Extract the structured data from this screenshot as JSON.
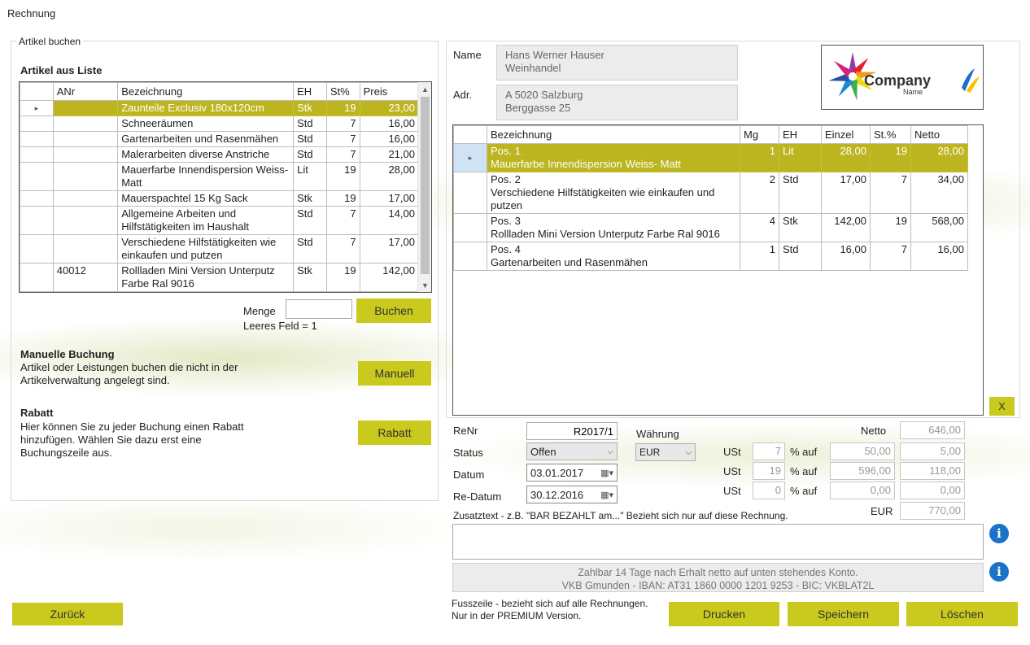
{
  "window": {
    "title": "Rechnung"
  },
  "left_panel": {
    "group_label": "Artikel buchen",
    "list_heading": "Artikel aus Liste",
    "columns": [
      "ANr",
      "Bezeichnung",
      "EH",
      "St%",
      "Preis"
    ],
    "rows": [
      {
        "anr": "",
        "bez": "Zaunteile Exclusiv 180x120cm",
        "eh": "Stk",
        "st": "19",
        "preis": "23,00",
        "selected": true
      },
      {
        "anr": "",
        "bez": "Schneeräumen",
        "eh": "Std",
        "st": "7",
        "preis": "16,00"
      },
      {
        "anr": "",
        "bez": "Gartenarbeiten und Rasenmähen",
        "eh": "Std",
        "st": "7",
        "preis": "16,00"
      },
      {
        "anr": "",
        "bez": "Malerarbeiten diverse Anstriche",
        "eh": "Std",
        "st": "7",
        "preis": "21,00"
      },
      {
        "anr": "",
        "bez": "Mauerfarbe Innendispersion Weiss- Matt",
        "eh": "Lit",
        "st": "19",
        "preis": "28,00"
      },
      {
        "anr": "",
        "bez": "Mauerspachtel 15 Kg Sack",
        "eh": "Stk",
        "st": "19",
        "preis": "17,00"
      },
      {
        "anr": "",
        "bez": "Allgemeine Arbeiten und Hilfstätigkeiten im Haushalt",
        "eh": "Std",
        "st": "7",
        "preis": "14,00"
      },
      {
        "anr": "",
        "bez": "Verschiedene Hilfstätigkeiten wie einkaufen und putzen",
        "eh": "Std",
        "st": "7",
        "preis": "17,00"
      },
      {
        "anr": "40012",
        "bez": "Rollladen Mini Version Unterputz Farbe Ral 9016",
        "eh": "Stk",
        "st": "19",
        "preis": "142,00"
      }
    ],
    "menge_label": "Menge",
    "menge_value": "",
    "menge_hint": "Leeres Feld = 1",
    "buchen_label": "Buchen",
    "manuelle_heading": "Manuelle Buchung",
    "manuelle_text": "Artikel oder Leistungen buchen die nicht in der Artikelverwaltung angelegt sind.",
    "manuell_label": "Manuell",
    "rabatt_heading": "Rabatt",
    "rabatt_text": "Hier können Sie zu jeder Buchung einen Rabatt hinzufügen. Wählen Sie dazu erst eine Buchungszeile aus.",
    "rabatt_label": "Rabatt"
  },
  "customer": {
    "name_label": "Name",
    "name_line1": "Hans Werner Hauser",
    "name_line2": "Weinhandel",
    "adr_label": "Adr.",
    "adr_line1": "A 5020 Salzburg",
    "adr_line2": "Berggasse 25",
    "logo_text": "Company",
    "logo_subtext": "Name"
  },
  "invoice_grid": {
    "columns": [
      "Bezeichnung",
      "Mg",
      "EH",
      "Einzel",
      "St.%",
      "Netto"
    ],
    "rows": [
      {
        "pos": "Pos. 1",
        "desc": "Mauerfarbe Innendispersion Weiss- Matt",
        "mg": "1",
        "eh": "Lit",
        "einzel": "28,00",
        "st": "19",
        "netto": "28,00",
        "selected": true
      },
      {
        "pos": "Pos. 2",
        "desc": "Verschiedene Hilfstätigkeiten wie einkaufen und putzen",
        "mg": "2",
        "eh": "Std",
        "einzel": "17,00",
        "st": "7",
        "netto": "34,00"
      },
      {
        "pos": "Pos. 3",
        "desc": "Rollladen Mini Version Unterputz Farbe Ral 9016",
        "mg": "4",
        "eh": "Stk",
        "einzel": "142,00",
        "st": "19",
        "netto": "568,00"
      },
      {
        "pos": "Pos. 4",
        "desc": "Gartenarbeiten und Rasenmähen",
        "mg": "1",
        "eh": "Std",
        "einzel": "16,00",
        "st": "7",
        "netto": "16,00"
      }
    ],
    "delete_label": "X"
  },
  "meta": {
    "renr_label": "ReNr",
    "renr_value": "R2017/1",
    "status_label": "Status",
    "status_value": "Offen",
    "datum_label": "Datum",
    "datum_value": "03.01.2017",
    "redatum_label": "Re-Datum",
    "redatum_value": "30.12.2016",
    "waehrung_label": "Währung",
    "waehrung_value": "EUR"
  },
  "totals": {
    "netto_label": "Netto",
    "netto_value": "646,00",
    "ust_label": "USt",
    "auf_label": "% auf",
    "ust_rows": [
      {
        "rate": "7",
        "base": "50,00",
        "amount": "5,00"
      },
      {
        "rate": "19",
        "base": "596,00",
        "amount": "118,00"
      },
      {
        "rate": "0",
        "base": "0,00",
        "amount": "0,00"
      }
    ],
    "eur_label": "EUR",
    "eur_value": "770,00"
  },
  "zusatz": {
    "label": "Zusatztext - z.B.  \"BAR BEZAHLT am...\" Bezieht sich nur auf diese Rechnung.",
    "value": ""
  },
  "footer_box": {
    "line1": "Zahlbar 14 Tage nach Erhalt netto auf unten stehendes Konto.",
    "line2": "VKB Gmunden - IBAN: AT31 1860 0000 1201 9253 - BIC: VKBLAT2L"
  },
  "footer_note": {
    "line1": "Fusszeile - bezieht sich auf alle Rechnungen.",
    "line2": "Nur in der PREMIUM Version."
  },
  "buttons": {
    "zurueck": "Zurück",
    "drucken": "Drucken",
    "speichern": "Speichern",
    "loeschen": "Löschen"
  },
  "icons": {
    "info": "i",
    "row_indicator": "▸"
  },
  "colors": {
    "accent": "#c9c91e",
    "selected_row": "#bdb520",
    "info_blue": "#1a73c9"
  }
}
